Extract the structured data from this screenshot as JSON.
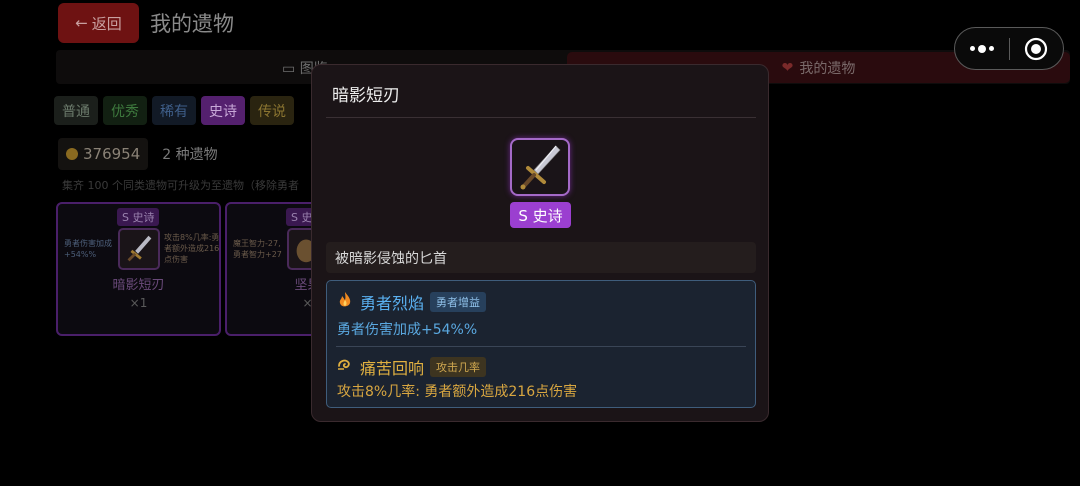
{
  "header": {
    "back_label": "返回",
    "back_arrow": "←",
    "title": "我的遗物"
  },
  "tabs": {
    "collection_label": "图鉴",
    "collection_icon": "book-icon",
    "mine_label": "我的遗物",
    "mine_icon": "ribbon-icon"
  },
  "rarity_filters": [
    "普通",
    "优秀",
    "稀有",
    "史诗",
    "传说"
  ],
  "selected_rarity": "史诗",
  "gold": {
    "icon": "coin-icon",
    "amount": "376954",
    "relic_count": "2 种遗物"
  },
  "hint": "集齐 100 个同类遗物可升级为至遗物（移除勇者",
  "cards": [
    {
      "badge": "S 史诗",
      "left_note": "勇者伤害加成+54%%",
      "right_note": "攻击8%几率:勇者额外造成216点伤害",
      "name": "暗影短刃",
      "qty": "×1"
    },
    {
      "badge": "S 史",
      "left_note": "魔王智力-27, 勇者智力+27",
      "right_note": "",
      "name": "坚果",
      "qty": "×"
    }
  ],
  "capsule": {
    "menu_icon": "more-dots-icon",
    "close_icon": "target-close-icon"
  },
  "modal": {
    "title": "暗影短刃",
    "rarity_label": "S 史诗",
    "description": "被暗影侵蚀的匕首",
    "effects": [
      {
        "icon": "fire-icon",
        "name": "勇者烈焰",
        "tag": "勇者增益",
        "desc": "勇者伤害加成+54%%"
      },
      {
        "icon": "swirl-icon",
        "name": "痛苦回响",
        "tag": "攻击几率",
        "desc": "攻击8%几率: 勇者额外造成216点伤害"
      }
    ]
  },
  "colors": {
    "epic": "#9b3fd0",
    "effect_buff": "#5ab0f0",
    "effect_chance": "#e0b040",
    "back_button": "#6e1212"
  }
}
